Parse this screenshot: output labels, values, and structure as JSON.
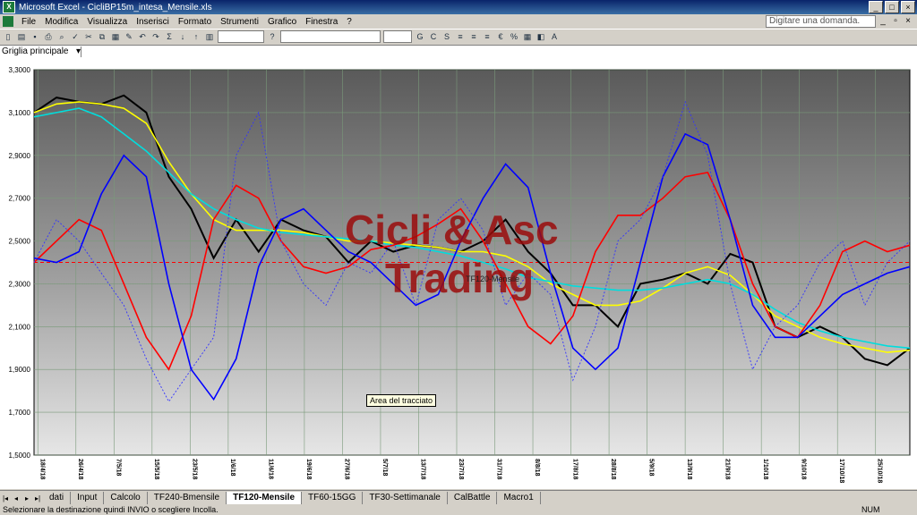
{
  "window": {
    "title": "Microsoft Excel - CicliBP15m_intesa_Mensile.xls",
    "app_icon": "excel-icon"
  },
  "menu": [
    "File",
    "Modifica",
    "Visualizza",
    "Inserisci",
    "Formato",
    "Strumenti",
    "Grafico",
    "Finestra",
    "?"
  ],
  "help_placeholder": "Digitare una domanda.",
  "namebox": {
    "value": "Griglia principale ..."
  },
  "watermark": {
    "line1": "Cicli & Asc",
    "line2": "Trading"
  },
  "series_label": "TF120-Mensile",
  "tooltip": "Area del tracciato",
  "sheet_tabs": [
    "dati",
    "Input",
    "Calcolo",
    "TF240-Bmensile",
    "TF120-Mensile",
    "TF60-15GG",
    "TF30-Settimanale",
    "CalBattle",
    "Macro1"
  ],
  "active_tab": "TF120-Mensile",
  "status": {
    "message": "Selezionare la destinazione quindi INVIO o scegliere Incolla.",
    "num": "NUM"
  },
  "chart_data": {
    "type": "line",
    "ylim": [
      1.5,
      3.3
    ],
    "yticks": [
      "3,3000",
      "3,1000",
      "2,9000",
      "2,7000",
      "2,5000",
      "2,3000",
      "2,1000",
      "1,9000",
      "1,7000",
      "1,5000"
    ],
    "xticks": [
      "18/4/18",
      "26/4/18",
      "7/5/18",
      "15/5/18",
      "23/5/18",
      "1/6/18",
      "11/6/18",
      "19/6/18",
      "27/6/18",
      "5/7/18",
      "13/7/18",
      "23/7/18",
      "31/7/18",
      "8/8/18",
      "17/8/18",
      "28/8/18",
      "5/9/18",
      "13/9/18",
      "21/9/18",
      "1/10/18",
      "9/10/18",
      "17/10/18",
      "25/10/18"
    ],
    "reference_line": 2.4,
    "series": [
      {
        "color": "#000000",
        "values": [
          3.1,
          3.17,
          3.15,
          3.14,
          3.18,
          3.1,
          2.8,
          2.65,
          2.42,
          2.6,
          2.45,
          2.6,
          2.55,
          2.52,
          2.4,
          2.5,
          2.45,
          2.48,
          2.47,
          2.45,
          2.5,
          2.6,
          2.45,
          2.35,
          2.2,
          2.2,
          2.1,
          2.3,
          2.32,
          2.35,
          2.3,
          2.44,
          2.4,
          2.1,
          2.05,
          2.1,
          2.05,
          1.95,
          1.92,
          2.0
        ]
      },
      {
        "color": "#ffff00",
        "values": [
          3.1,
          3.14,
          3.15,
          3.14,
          3.12,
          3.05,
          2.87,
          2.72,
          2.6,
          2.55,
          2.55,
          2.55,
          2.54,
          2.52,
          2.5,
          2.5,
          2.49,
          2.48,
          2.47,
          2.45,
          2.45,
          2.43,
          2.38,
          2.3,
          2.25,
          2.2,
          2.2,
          2.22,
          2.28,
          2.35,
          2.38,
          2.34,
          2.25,
          2.15,
          2.1,
          2.05,
          2.02,
          2.0,
          1.98,
          1.99
        ]
      },
      {
        "color": "#00dddd",
        "values": [
          3.08,
          3.1,
          3.12,
          3.08,
          3.0,
          2.92,
          2.82,
          2.72,
          2.65,
          2.6,
          2.56,
          2.54,
          2.53,
          2.52,
          2.51,
          2.5,
          2.48,
          2.47,
          2.45,
          2.43,
          2.4,
          2.37,
          2.33,
          2.31,
          2.29,
          2.28,
          2.27,
          2.27,
          2.28,
          2.3,
          2.32,
          2.3,
          2.25,
          2.18,
          2.12,
          2.08,
          2.05,
          2.03,
          2.01,
          2.0
        ]
      },
      {
        "color": "#ff0000",
        "values": [
          2.4,
          2.5,
          2.6,
          2.55,
          2.3,
          2.05,
          1.9,
          2.15,
          2.6,
          2.76,
          2.7,
          2.5,
          2.38,
          2.35,
          2.38,
          2.46,
          2.48,
          2.52,
          2.58,
          2.65,
          2.5,
          2.3,
          2.1,
          2.02,
          2.15,
          2.45,
          2.62,
          2.62,
          2.7,
          2.8,
          2.82,
          2.6,
          2.3,
          2.1,
          2.05,
          2.2,
          2.45,
          2.5,
          2.45,
          2.48
        ]
      },
      {
        "color": "#0000ff",
        "values": [
          2.42,
          2.4,
          2.45,
          2.72,
          2.9,
          2.8,
          2.3,
          1.9,
          1.76,
          1.95,
          2.38,
          2.6,
          2.65,
          2.55,
          2.45,
          2.4,
          2.3,
          2.2,
          2.25,
          2.5,
          2.7,
          2.86,
          2.75,
          2.35,
          2.0,
          1.9,
          2.0,
          2.4,
          2.8,
          3.0,
          2.95,
          2.6,
          2.2,
          2.05,
          2.05,
          2.15,
          2.25,
          2.3,
          2.35,
          2.38
        ]
      },
      {
        "color": "#3333ff",
        "dashed": true,
        "values": [
          2.4,
          2.6,
          2.5,
          2.35,
          2.2,
          1.95,
          1.75,
          1.9,
          2.05,
          2.9,
          3.1,
          2.5,
          2.3,
          2.2,
          2.4,
          2.35,
          2.5,
          2.2,
          2.6,
          2.7,
          2.55,
          2.2,
          2.35,
          2.25,
          1.85,
          2.1,
          2.5,
          2.6,
          2.8,
          3.15,
          2.9,
          2.3,
          1.9,
          2.1,
          2.2,
          2.4,
          2.5,
          2.2,
          2.4,
          2.5
        ]
      }
    ]
  }
}
